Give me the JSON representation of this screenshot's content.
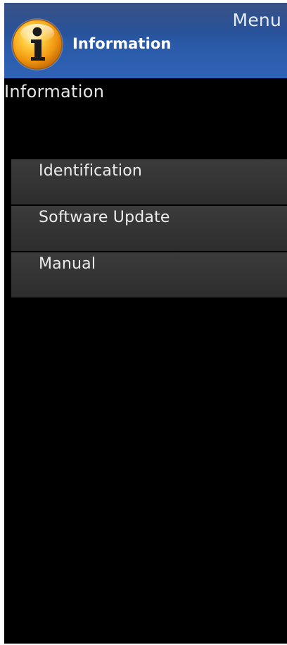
{
  "header": {
    "menu_label": "Menu",
    "icon": "info-circle-icon",
    "title": "Information"
  },
  "section": {
    "title": "Information"
  },
  "menu_items": [
    {
      "label": "Identification"
    },
    {
      "label": "Software Update"
    },
    {
      "label": "Manual"
    }
  ],
  "colors": {
    "header_blue": "#2a5aa8",
    "panel_background": "#000000",
    "item_background": "#363636",
    "icon_gold": "#f2a31c"
  }
}
